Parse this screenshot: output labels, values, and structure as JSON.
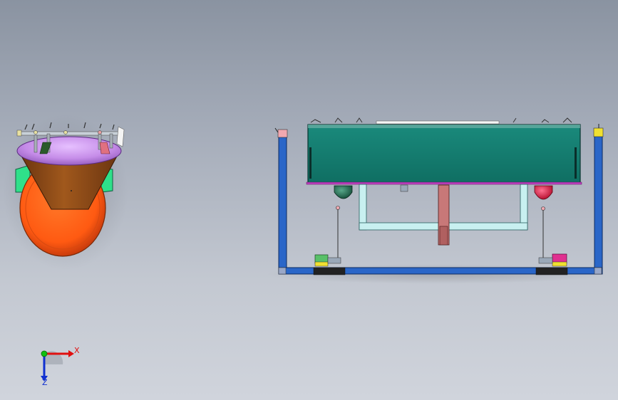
{
  "viewport": {
    "triad": {
      "x_label": "X",
      "z_label": "Z"
    },
    "colors": {
      "x_axis": "#e01010",
      "y_axis": "#10c010",
      "z_axis": "#1030d0",
      "frame_blue": "#2a66c8",
      "tank_teal": "#127a6e",
      "cone_brown": "#8a4a18",
      "dome_purple": "#c58ce8",
      "bowl_orange": "#ff5a12",
      "lamp_green": "#1e6e50",
      "lamp_red": "#e0103a"
    },
    "icons": [
      "coordinate-triad-icon"
    ]
  }
}
